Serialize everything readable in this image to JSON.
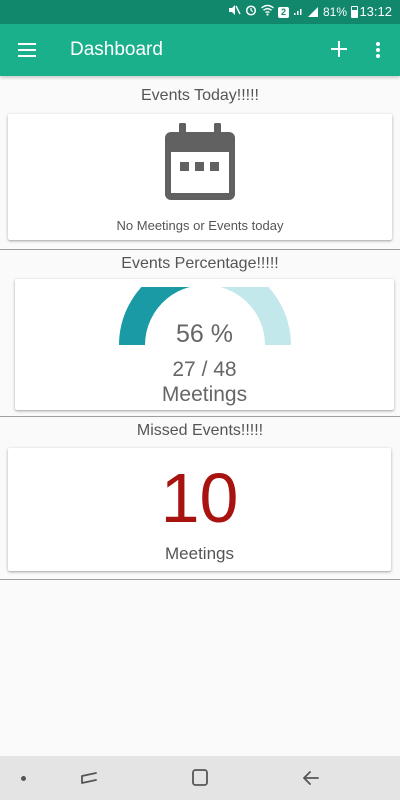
{
  "status_bar": {
    "badge": "2",
    "battery": "81%",
    "time": "13:12"
  },
  "app_bar": {
    "title": "Dashboard",
    "menu_icon": "menu-icon",
    "add_icon": "add-icon",
    "more_icon": "more-vert-icon"
  },
  "events_today": {
    "title": "Events Today!!!!!",
    "icon": "calendar-icon",
    "message": "No Meetings or Events today"
  },
  "events_percentage": {
    "title": "Events Percentage!!!!!",
    "percent_label": "56 %",
    "progress_fraction": 0.56,
    "count_label": "27 / 48",
    "unit": "Meetings",
    "fill_color": "#1a9aa4",
    "track_color": "#c3e8ec"
  },
  "missed_events": {
    "title": "Missed Events!!!!!",
    "count": "10",
    "unit": "Meetings",
    "count_color": "#a8120f"
  },
  "colors": {
    "primary": "#1bb08c",
    "primary_dark": "#11876c"
  },
  "nav_bar": {
    "icons": [
      "dot-icon",
      "recents-icon",
      "home-icon",
      "back-icon"
    ]
  }
}
